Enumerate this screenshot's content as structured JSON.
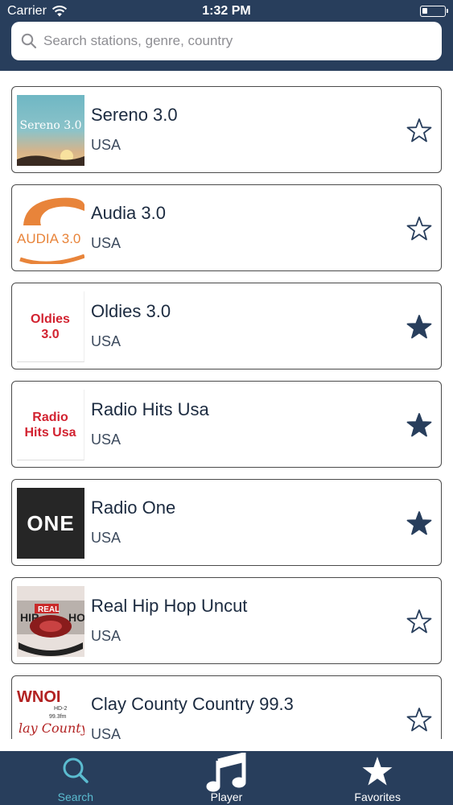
{
  "status_bar": {
    "carrier": "Carrier",
    "time": "1:32 PM"
  },
  "search": {
    "placeholder": "Search stations, genre, country"
  },
  "stations": [
    {
      "name": "Sereno 3.0",
      "country": "USA",
      "favorite": false,
      "logo_text": "Sereno 3.0"
    },
    {
      "name": "Audia 3.0",
      "country": "USA",
      "favorite": false,
      "logo_text": "AUDIA 3.0"
    },
    {
      "name": "Oldies 3.0",
      "country": "USA",
      "favorite": true,
      "logo_text": "Oldies 3.0"
    },
    {
      "name": "Radio Hits Usa",
      "country": "USA",
      "favorite": true,
      "logo_text": "Radio Hits Usa"
    },
    {
      "name": "Radio One",
      "country": "USA",
      "favorite": true,
      "logo_text": "ONE"
    },
    {
      "name": "Real Hip Hop Uncut",
      "country": "USA",
      "favorite": false,
      "logo_text": "REAL"
    },
    {
      "name": "Clay County Country 99.3",
      "country": "USA",
      "favorite": false,
      "logo_text": "WNOI"
    }
  ],
  "tabs": [
    {
      "label": "Search",
      "icon": "search-icon",
      "active": true
    },
    {
      "label": "Player",
      "icon": "music-note-icon",
      "active": false
    },
    {
      "label": "Favorites",
      "icon": "star-icon",
      "active": false
    }
  ],
  "colors": {
    "header": "#283e5c",
    "accent": "#5bbcd0",
    "star": "#283e5c",
    "logo_red": "#d22230"
  }
}
